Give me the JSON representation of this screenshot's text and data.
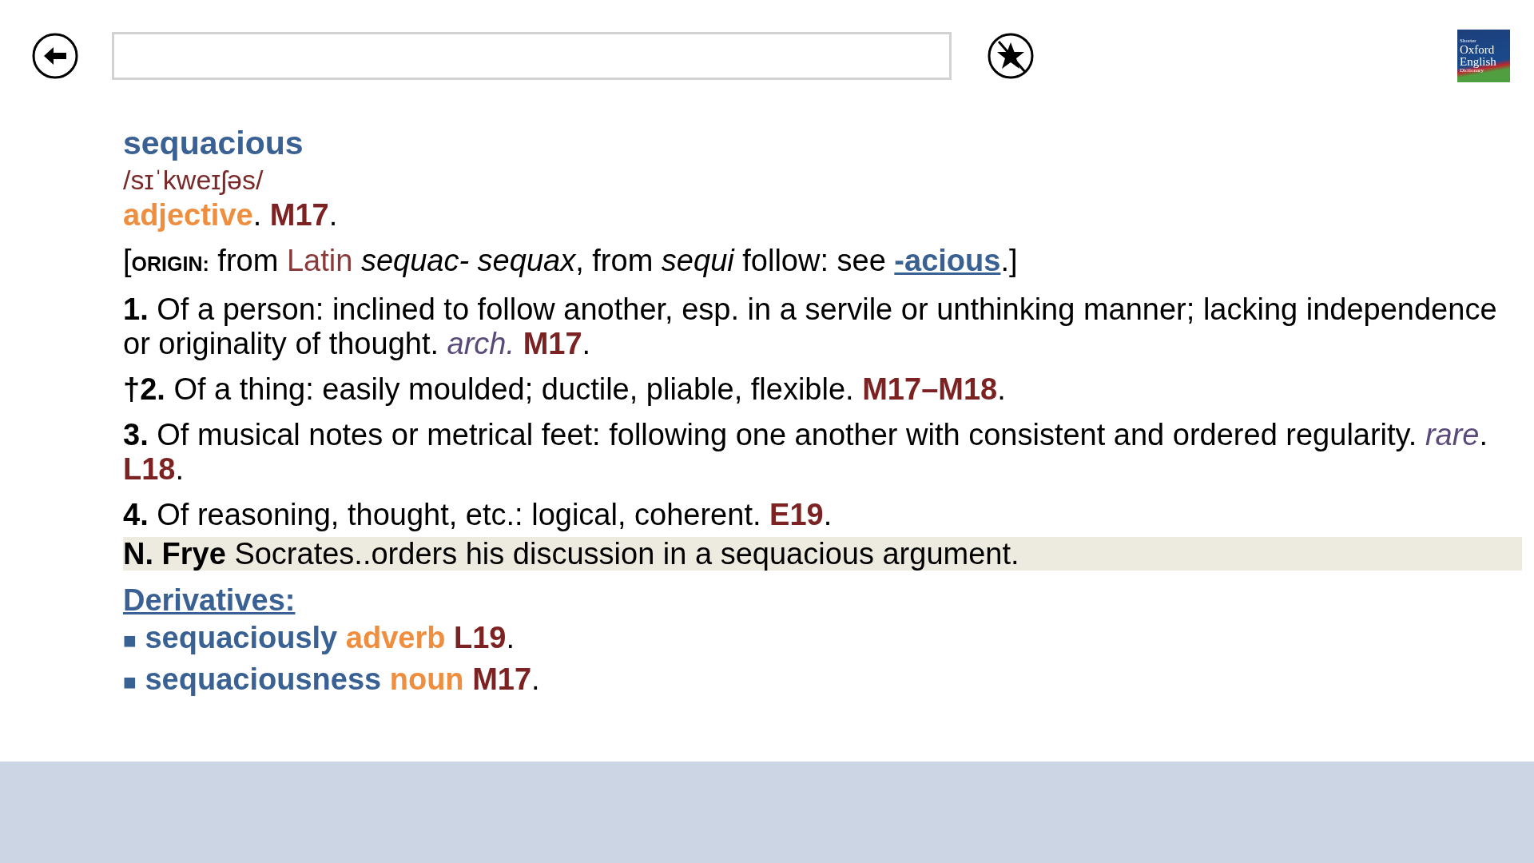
{
  "toolbar": {
    "logo": {
      "lines": [
        "Shorter",
        "Oxford",
        "English",
        "Dictionary"
      ]
    }
  },
  "entry": {
    "headword": "sequacious",
    "pronunciation": "/sɪˈkweɪʃəs/",
    "grammar": [
      {
        "kind": "pos",
        "text": "adjective"
      },
      {
        "kind": "plain",
        "text": "."
      },
      {
        "kind": "space"
      },
      {
        "kind": "date",
        "text": "M17"
      },
      {
        "kind": "plain",
        "text": "."
      }
    ],
    "origin": [
      {
        "kind": "plain",
        "text": "["
      },
      {
        "kind": "label",
        "text": "ORIGIN:"
      },
      {
        "kind": "plain",
        "text": " from "
      },
      {
        "kind": "lang",
        "text": "Latin"
      },
      {
        "kind": "space"
      },
      {
        "kind": "italic",
        "text": "sequac- sequax"
      },
      {
        "kind": "plain",
        "text": ", from "
      },
      {
        "kind": "italic",
        "text": "sequi"
      },
      {
        "kind": "plain",
        "text": " follow: see "
      },
      {
        "kind": "link",
        "text": "-acious"
      },
      {
        "kind": "plain",
        "text": ".]"
      }
    ],
    "senses": [
      {
        "number": "1.",
        "segments": [
          {
            "kind": "plain",
            "text": " Of a person: inclined to follow another, esp. in a servile or unthinking manner; lacking independence or originality of thought. "
          },
          {
            "kind": "usage",
            "text": "arch."
          },
          {
            "kind": "space"
          },
          {
            "kind": "date",
            "text": "M17"
          },
          {
            "kind": "plain",
            "text": "."
          }
        ]
      },
      {
        "number": "†2.",
        "segments": [
          {
            "kind": "plain",
            "text": " Of a thing: easily moulded; ductile, pliable, flexible. "
          },
          {
            "kind": "date",
            "text": "M17–M18"
          },
          {
            "kind": "plain",
            "text": "."
          }
        ]
      },
      {
        "number": "3.",
        "segments": [
          {
            "kind": "plain",
            "text": " Of musical notes or metrical feet: following one another with consistent and ordered regularity. "
          },
          {
            "kind": "usage",
            "text": "rare"
          },
          {
            "kind": "plain",
            "text": ". "
          },
          {
            "kind": "date",
            "text": "L18"
          },
          {
            "kind": "plain",
            "text": "."
          }
        ]
      },
      {
        "number": "4.",
        "segments": [
          {
            "kind": "plain",
            "text": " Of reasoning, thought, etc.: logical, coherent. "
          },
          {
            "kind": "date",
            "text": "E19"
          },
          {
            "kind": "plain",
            "text": "."
          }
        ]
      }
    ],
    "quotation": {
      "author": "N. Frye",
      "text": " Socrates..orders his discussion in a sequacious argument."
    },
    "derivatives": {
      "heading": "Derivatives:",
      "items": [
        {
          "bullet": "■",
          "word": "sequaciously",
          "pos": "adverb",
          "date": "L19",
          "end": "."
        },
        {
          "bullet": "■",
          "word": "sequaciousness",
          "pos": "noun",
          "date": "M17",
          "end": "."
        }
      ]
    }
  }
}
